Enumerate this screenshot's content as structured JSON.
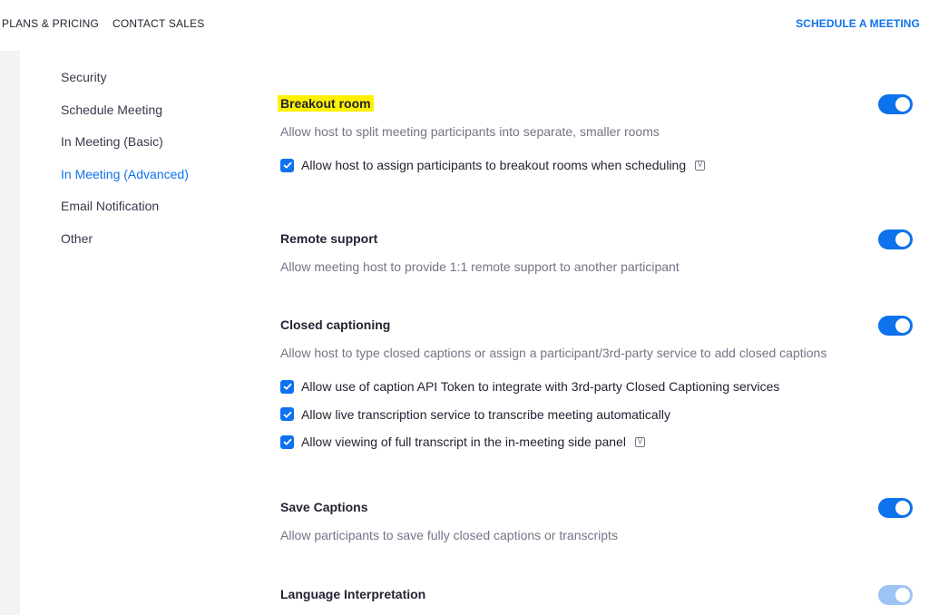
{
  "topnav": {
    "plans_pricing": "PLANS & PRICING",
    "contact_sales": "CONTACT SALES",
    "schedule_meeting": "SCHEDULE A MEETING"
  },
  "sidebar": {
    "items": [
      {
        "label": "Security"
      },
      {
        "label": "Schedule Meeting"
      },
      {
        "label": "In Meeting (Basic)"
      },
      {
        "label": "In Meeting (Advanced)",
        "active": true
      },
      {
        "label": "Email Notification"
      },
      {
        "label": "Other"
      }
    ]
  },
  "settings": {
    "breakout_room": {
      "title": "Breakout room",
      "description": "Allow host to split meeting participants into separate, smaller rooms",
      "enabled": true,
      "options": [
        {
          "label": "Allow host to assign participants to breakout rooms when scheduling",
          "checked": true,
          "info_icon": "verified-icon"
        }
      ]
    },
    "remote_support": {
      "title": "Remote support",
      "description": "Allow meeting host to provide 1:1 remote support to another participant",
      "enabled": true
    },
    "closed_captioning": {
      "title": "Closed captioning",
      "description": "Allow host to type closed captions or assign a participant/3rd-party service to add closed captions",
      "enabled": true,
      "options": [
        {
          "label": "Allow use of caption API Token to integrate with 3rd-party Closed Captioning services",
          "checked": true
        },
        {
          "label": "Allow live transcription service to transcribe meeting automatically",
          "checked": true
        },
        {
          "label": "Allow viewing of full transcript in the in-meeting side panel",
          "checked": true,
          "info_icon": "verified-icon"
        }
      ]
    },
    "save_captions": {
      "title": "Save Captions",
      "description": "Allow participants to save fully closed captions or transcripts",
      "enabled": true
    },
    "language_interpretation": {
      "title": "Language Interpretation",
      "enabled": true
    }
  },
  "icons": {
    "verified_glyph": "V"
  },
  "colors": {
    "accent": "#0e72ed",
    "highlight": "#fff200",
    "text_primary": "#232333",
    "text_secondary": "#747487"
  }
}
